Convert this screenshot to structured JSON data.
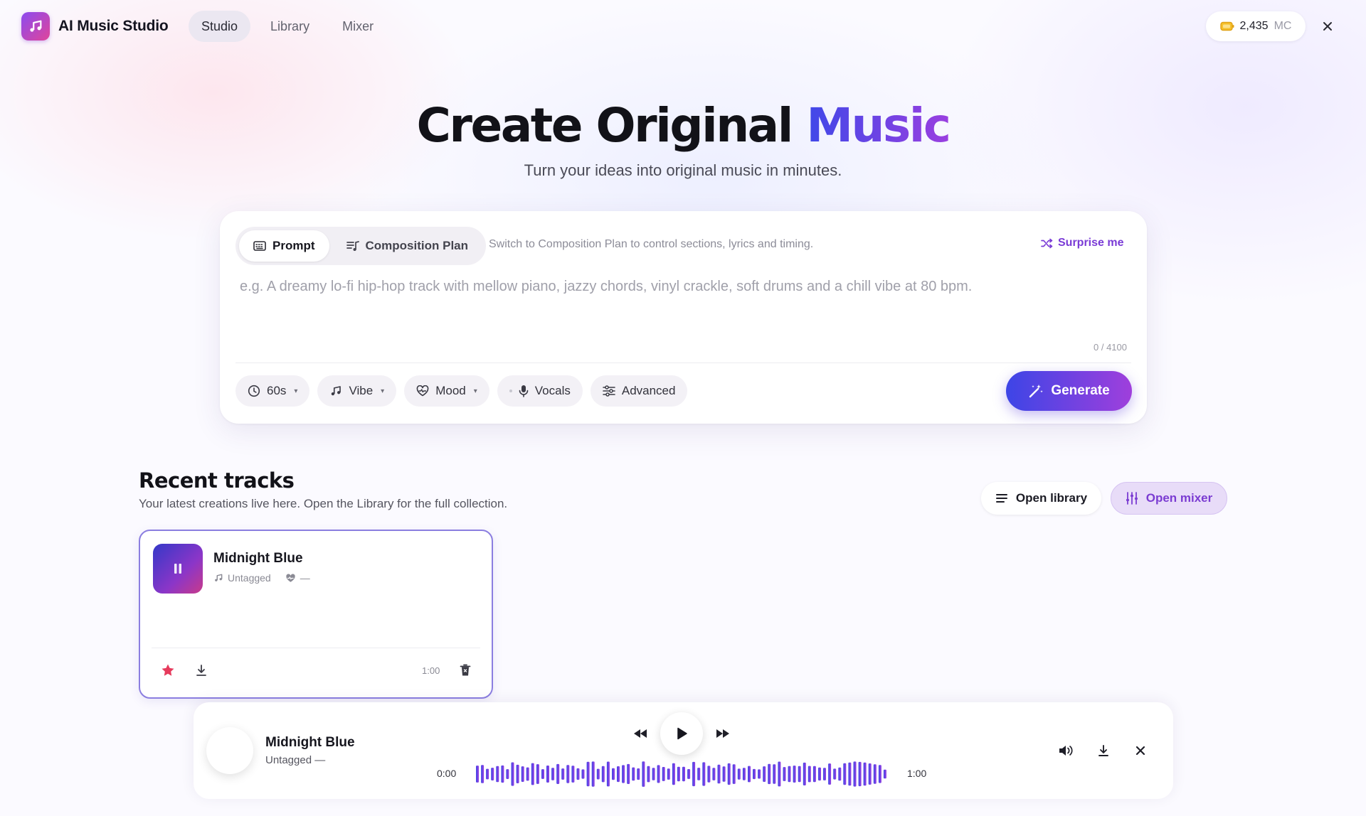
{
  "app": {
    "name": "AI Music Studio",
    "brand_gradient": [
      "#8b4bf0",
      "#e0459a"
    ],
    "accent": "#7b3cd2"
  },
  "nav": {
    "tabs": [
      {
        "label": "Studio",
        "active": true
      },
      {
        "label": "Library",
        "active": false
      },
      {
        "label": "Mixer",
        "active": false
      }
    ]
  },
  "credits": {
    "value": "2,435",
    "unit": "MC",
    "icon": "coin-icon"
  },
  "hero": {
    "title_main": "Create Original",
    "title_accent": "Music",
    "subtitle": "Turn your ideas into original music in minutes."
  },
  "composer": {
    "modes": [
      {
        "label": "Prompt",
        "icon": "keyboard-icon",
        "active": true
      },
      {
        "label": "Composition Plan",
        "icon": "plan-icon",
        "active": false
      }
    ],
    "mode_hint": "Switch to Composition Plan to control sections, lyrics and timing.",
    "surprise_label": "Surprise me",
    "prompt_placeholder": "e.g. A dreamy lo-fi hip-hop track with mellow piano, jazzy chords, vinyl crackle, soft drums and a chill vibe at 80 bpm.",
    "prompt_value": "",
    "char_count": "0 / 4100",
    "chips": {
      "duration": "60s",
      "vibe": "Vibe",
      "mood": "Mood",
      "vocals": "Vocals",
      "advanced": "Advanced"
    },
    "generate_label": "Generate",
    "generate_gradient": [
      "#3d45e6",
      "#9f3fdc"
    ]
  },
  "recent": {
    "title": "Recent tracks",
    "subtitle": "Your latest creations live here. Open the Library for the full collection.",
    "open_library_label": "Open library",
    "open_mixer_label": "Open mixer",
    "tracks": [
      {
        "name": "Midnight Blue",
        "genre": "Untagged",
        "mood": "—",
        "duration": "1:00",
        "playing": true,
        "favorited": true
      }
    ]
  },
  "player": {
    "title": "Midnight Blue",
    "subtitle": "Untagged —",
    "current_time": "0:00",
    "total_time": "1:00",
    "progress": 0,
    "waveform_colors": [
      "#3f48e8",
      "#9a3fe0"
    ]
  }
}
